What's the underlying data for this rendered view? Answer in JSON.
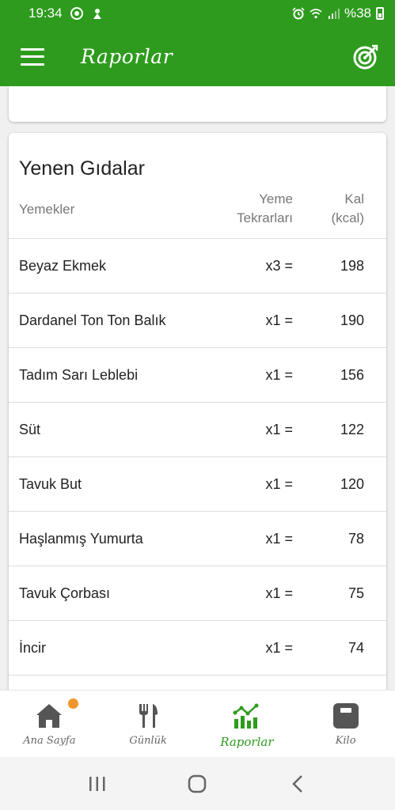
{
  "status_bar": {
    "time": "19:34",
    "battery": "%38"
  },
  "app_bar": {
    "title": "Raporlar"
  },
  "eaten_foods": {
    "title": "Yenen Gıdalar",
    "columns": {
      "name": "Yemekler",
      "repeats_line1": "Yeme",
      "repeats_line2": "Tekrarları",
      "kcal_line1": "Kal",
      "kcal_line2": "(kcal)"
    },
    "rows": [
      {
        "name": "Beyaz Ekmek",
        "repeats": "x3 =",
        "kcal": "198"
      },
      {
        "name": "Dardanel Ton Ton Balık",
        "repeats": "x1 =",
        "kcal": "190"
      },
      {
        "name": "Tadım Sarı Leblebi",
        "repeats": "x1 =",
        "kcal": "156"
      },
      {
        "name": "Süt",
        "repeats": "x1 =",
        "kcal": "122"
      },
      {
        "name": "Tavuk But",
        "repeats": "x1 =",
        "kcal": "120"
      },
      {
        "name": "Haşlanmış Yumurta",
        "repeats": "x1 =",
        "kcal": "78"
      },
      {
        "name": "Tavuk Çorbası",
        "repeats": "x1 =",
        "kcal": "75"
      },
      {
        "name": "İncir",
        "repeats": "x1 =",
        "kcal": "74"
      },
      {
        "name": "",
        "repeats": "",
        "kcal": ""
      }
    ]
  },
  "bottom_nav": {
    "items": [
      {
        "label": "Ana Sayfa",
        "icon": "home-icon",
        "active": false
      },
      {
        "label": "Günlük",
        "icon": "fork-knife-icon",
        "active": false
      },
      {
        "label": "Raporlar",
        "icon": "chart-icon",
        "active": true
      },
      {
        "label": "Kilo",
        "icon": "scale-icon",
        "active": false
      }
    ]
  },
  "colors": {
    "brand_green": "#2e9b1e",
    "badge_orange": "#f0962b"
  }
}
